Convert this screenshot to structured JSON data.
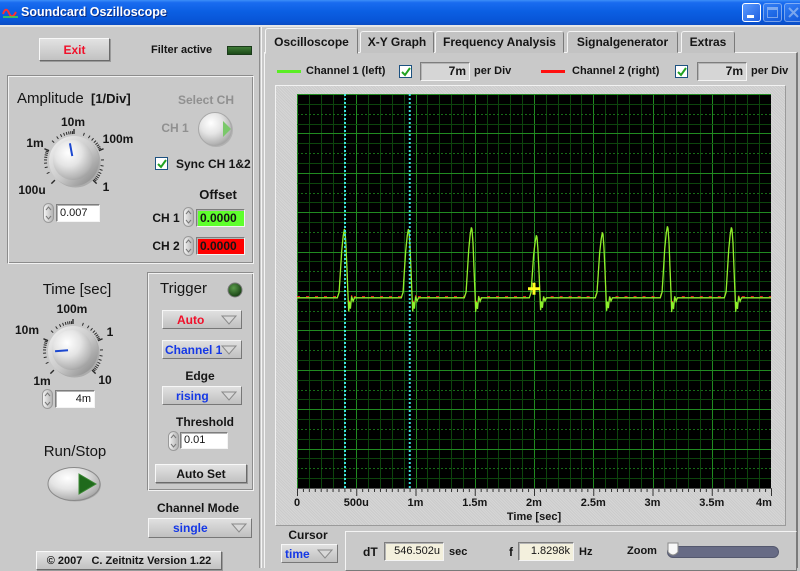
{
  "window": {
    "title": "Soundcard Oszilloscope",
    "icon": "oscilloscope-wave-icon",
    "controls": [
      "minimize-icon",
      "maximize-icon",
      "close-icon"
    ]
  },
  "colors": {
    "channel1": "#5aee24",
    "channel2": "#ff1010",
    "trace1": "#8ef02c",
    "trace2": "#ff2020",
    "cursor": "#3fe0e0",
    "marker": "#ffff20",
    "plot_bg": "#000000",
    "grid_major": "#218a21",
    "grid_half": "#176a17",
    "grid_minor": "#0d440d",
    "offset_ch1_bg": "#5eff2c",
    "offset_ch2_bg": "#ff0000",
    "led_off": "#22561e",
    "led_on": "#3cff3c",
    "readout_bg": "#f3f0dd",
    "scale_field_bg": "#d6d6d6"
  },
  "left_panel": {
    "exit_button": "Exit",
    "filter": {
      "label": "Filter active",
      "active": false
    },
    "amplitude": {
      "title": "Amplitude",
      "unit": "[1/Div]",
      "scale": {
        "min": "100u",
        "low": "1m",
        "mid": "10m",
        "high": "100m",
        "max": "1"
      },
      "knob_value": 0.007,
      "knob_min": 0.0001,
      "knob_max": 1,
      "value": "0.007"
    },
    "select_ch": {
      "title": "Select CH",
      "label": "CH 1",
      "enabled": false
    },
    "sync": {
      "label": "Sync CH 1&2",
      "checked": true
    },
    "offset": {
      "title": "Offset",
      "ch1": {
        "label": "CH 1",
        "value": "0.0000"
      },
      "ch2": {
        "label": "CH 2",
        "value": "0.0000"
      }
    },
    "time": {
      "title": "Time [sec]",
      "scale": {
        "min": "1m",
        "low": "10m",
        "mid": "100m",
        "high": "1",
        "max": "10"
      },
      "knob_value": 0.004,
      "knob_min": 0.001,
      "knob_max": 10,
      "value": "4m"
    },
    "run_stop": {
      "label": "Run/Stop",
      "running": true
    },
    "trigger": {
      "title": "Trigger",
      "led_on": false,
      "mode": "Auto",
      "source": "Channel 1",
      "edge_label": "Edge",
      "edge": "rising",
      "threshold_label": "Threshold",
      "threshold": "0.01",
      "auto_set": "Auto Set"
    },
    "channel_mode": {
      "label": "Channel Mode",
      "value": "single"
    },
    "copyright": "© 2007   C. Zeitnitz Version 1.22"
  },
  "tabs": [
    {
      "label": "Oscilloscope",
      "active": true
    },
    {
      "label": "X-Y Graph",
      "active": false
    },
    {
      "label": "Frequency Analysis",
      "active": false
    },
    {
      "label": "Signalgenerator",
      "active": false
    },
    {
      "label": "Extras",
      "active": false
    }
  ],
  "legend": {
    "ch1": {
      "label": "Channel 1 (left)",
      "enabled": true,
      "per_div": "7m",
      "per_div_unit": "per Div"
    },
    "ch2": {
      "label": "Channel 2 (right)",
      "enabled": true,
      "per_div": "7m",
      "per_div_unit": "per Div"
    }
  },
  "cursor_bar": {
    "label": "Cursor",
    "mode": "time",
    "dt_label": "dT",
    "dt_value": "546.502u",
    "dt_unit": "sec",
    "f_label": "f",
    "f_value": "1.8298k",
    "f_unit": "Hz",
    "zoom_label": "Zoom",
    "zoom_level": 0
  },
  "chart_data": {
    "type": "line",
    "title": "",
    "xlabel": "Time [sec]",
    "ylabel": "",
    "x_unit": "ms",
    "y_unit": "mV",
    "xlim_ms": [
      0,
      4
    ],
    "ylim_mV": [
      -35,
      35
    ],
    "x_per_div_ms": 0.5,
    "y_per_div_mV": 7,
    "grid": true,
    "legend": "top",
    "x_ticks_ms": [
      0,
      0.5,
      1,
      1.5,
      2,
      2.5,
      3,
      3.5,
      4
    ],
    "x_tick_labels": [
      "0",
      "500u",
      "1m",
      "1.5m",
      "2m",
      "2.5m",
      "3m",
      "3.5m",
      "4m"
    ],
    "pulse_shape": {
      "dt_ms": [
        -0.065,
        -0.05,
        -0.04,
        -0.028,
        -0.015,
        -0.005,
        0,
        0.008,
        0.016,
        0.024,
        0.031,
        0.038,
        0.046,
        0.056,
        0.068,
        0.08
      ],
      "fraction": [
        0,
        0.08,
        0.35,
        0.68,
        0.9,
        1.0,
        0.97,
        0.78,
        0.45,
        0.1,
        -0.2,
        -0.06,
        -0.16,
        0.02,
        -0.05,
        0
      ]
    },
    "series": [
      {
        "name": "Channel 1 (left)",
        "baseline_mV": -1.2,
        "pulses": [
          {
            "t_ms": 0.405,
            "peak_mV": 11.0
          },
          {
            "t_ms": 0.945,
            "peak_mV": 11.0
          },
          {
            "t_ms": 1.477,
            "peak_mV": 11.3
          },
          {
            "t_ms": 2.025,
            "peak_mV": 9.9
          },
          {
            "t_ms": 2.582,
            "peak_mV": 10.4
          },
          {
            "t_ms": 3.131,
            "peak_mV": 11.5
          },
          {
            "t_ms": 3.671,
            "peak_mV": 11.3
          }
        ]
      },
      {
        "name": "Channel 2 (right)",
        "baseline_mV": -1.0,
        "pulses": [
          {
            "t_ms": 0.405,
            "peak_mV": 11.0
          },
          {
            "t_ms": 0.945,
            "peak_mV": 11.0
          },
          {
            "t_ms": 1.477,
            "peak_mV": 11.3
          },
          {
            "t_ms": 2.025,
            "peak_mV": 9.9
          },
          {
            "t_ms": 2.582,
            "peak_mV": 10.4
          },
          {
            "t_ms": 3.131,
            "peak_mV": 11.5
          },
          {
            "t_ms": 3.671,
            "peak_mV": 11.3
          }
        ]
      }
    ],
    "cursors_ms": [
      0.405,
      0.9515
    ],
    "marker": {
      "t_ms": 2.0,
      "v_mV": 0.4
    }
  }
}
